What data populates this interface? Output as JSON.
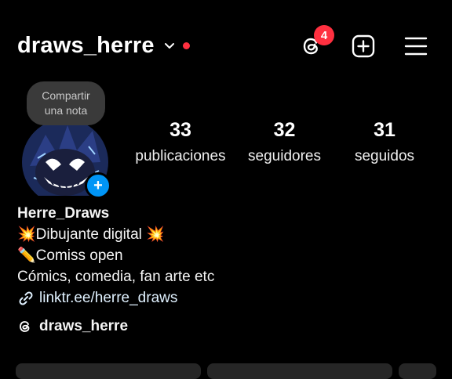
{
  "header": {
    "username": "draws_herre",
    "threads_badge_count": "4"
  },
  "note": {
    "line1": "Compartir",
    "line2": "una nota"
  },
  "stats": {
    "posts_value": "33",
    "posts_label": "publicaciones",
    "followers_value": "32",
    "followers_label": "seguidores",
    "following_value": "31",
    "following_label": "seguidos"
  },
  "bio": {
    "name": "Herre_Draws",
    "line1": "💥Dibujante digital 💥",
    "line2": "✏️Comiss open",
    "line3": "Cómics, comedia, fan arte etc",
    "link": "linktr.ee/herre_draws"
  },
  "threads_profile": {
    "handle": "draws_herre"
  },
  "colors": {
    "background": "#000000",
    "badge": "#ff3040",
    "add_story": "#0095f6"
  }
}
